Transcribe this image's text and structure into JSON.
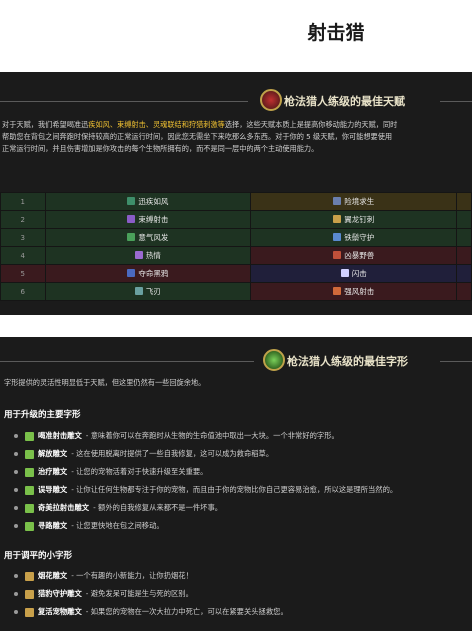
{
  "page": {
    "title": "射击猎"
  },
  "talents_section": {
    "title": "枪法猎人练级的最佳天赋",
    "intro": [
      {
        "text": "对于天赋，我们希望喝准迅",
        "hl": false
      },
      {
        "text": "疾如风、束缚射击、灵魂联结和狩猎刺激等",
        "hl": true
      },
      {
        "text": "选择，这些天赋本质上是提高你移动能力的天赋，同时",
        "hl": false
      }
    ],
    "line2": "帮助您在背包之间奔跑时保持较高的正常运行时间，因此您无需坐下来吃那么多东西。对于你的 5 级天赋，你可能想要使用",
    "line3": "正常运行时间，并且伤害增加是你攻击的每个生物所拥有的，而不是同一层中的两个主动使用能力。",
    "rows": [
      {
        "level": "1",
        "left": "迅疾如风",
        "right": "险境求生",
        "lc": "#1e3322",
        "rc": "#3a3217",
        "li": "#3e8f6a",
        "ri": "#6a7fae"
      },
      {
        "level": "2",
        "left": "束缚射击",
        "right": "翼龙钉刺",
        "lc": "#1e3322",
        "rc": "#1e3322",
        "li": "#8a5cc7",
        "ri": "#c8a04a"
      },
      {
        "level": "3",
        "left": "意气风发",
        "right": "铁鬃守护",
        "lc": "#1e3322",
        "rc": "#1e3322",
        "li": "#4aa05a",
        "ri": "#5a8ad0"
      },
      {
        "level": "4",
        "left": "热情",
        "right": "凶暴野兽",
        "lc": "#1e3322",
        "rc": "#3a1a1e",
        "li": "#9a6ad0",
        "ri": "#c0503a"
      },
      {
        "level": "5",
        "left": "夺命黑鸦",
        "right": "闪击",
        "lc": "#3a1a1e",
        "rc": "#201f3a",
        "li": "#4a6ac0",
        "ri": "#d0d0ff"
      },
      {
        "level": "6",
        "left": "飞刃",
        "right": "强风射击",
        "lc": "#1e3322",
        "rc": "#3a1a1e",
        "li": "#6aa0a0",
        "ri": "#d06a3a"
      }
    ]
  },
  "glyphs_section": {
    "title": "枪法猎人练级的最佳字形",
    "intro": "字形提供的灵活性明显低于天赋，但这里仍然有一些回旋余地。",
    "major_heading": "用于升级的主要字形",
    "major": [
      {
        "name": "喝准射击雕文",
        "desc": " - 意味着你可以在奔跑时从生物的生命值池中取出一大块。一个非常好的字形。"
      },
      {
        "name": "解放雕文",
        "desc": " - 这在使用脱离时提供了一些自我修复，这可以成为救命稻草。"
      },
      {
        "name": "治疗雕文",
        "desc": " - 让您的宠物活着对于快速升级至关重要。"
      },
      {
        "name": "误导雕文",
        "desc": " - 让你让任何生物都专注于你的宠物，而且由于你的宠物比你自己更容易治愈，所以这是理所当然的。"
      },
      {
        "name": "奇美拉射击雕文",
        "desc": " - 额外的自我修复从来都不是一件坏事。"
      },
      {
        "name": "寻路雕文",
        "desc": " - 让您更快地在包之间移动。"
      }
    ],
    "minor_heading": "用于调平的小字形",
    "minor": [
      {
        "name": "烟花雕文",
        "desc": " - 一个有趣的小新能力，让你扔烟花！"
      },
      {
        "name": "猎豹守护雕文",
        "desc": " - 避免发呆可能是生与死的区别。"
      },
      {
        "name": "复活宠物雕文",
        "desc": " - 如果您的宠物在一次大拉力中死亡，可以在紧要关头拯救您。"
      }
    ]
  }
}
